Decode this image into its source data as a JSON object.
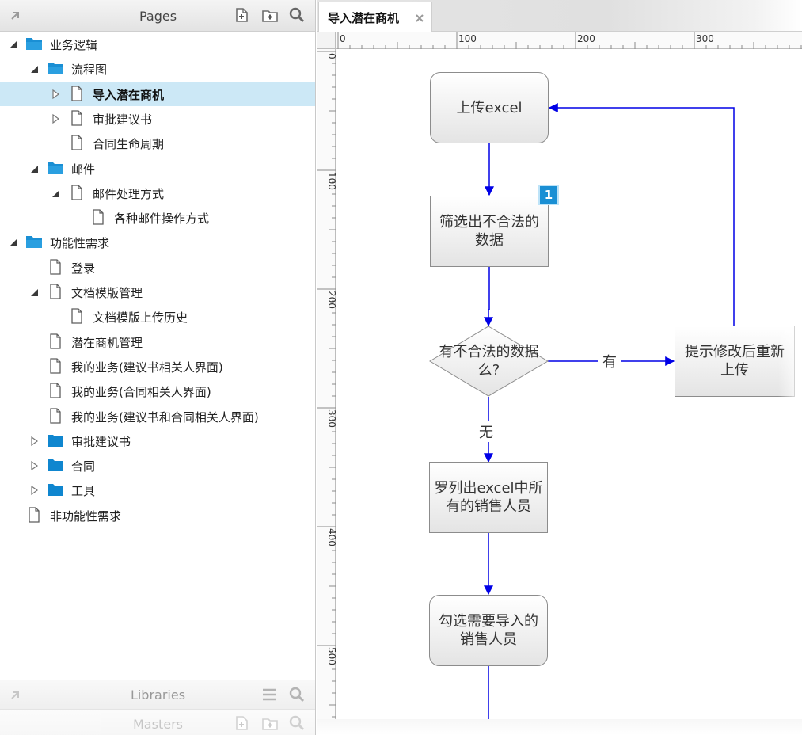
{
  "pages_panel": {
    "title": "Pages",
    "tree": [
      {
        "label": "业务逻辑",
        "icon": "folder-open-icon",
        "level": 0,
        "toggle": "expanded"
      },
      {
        "label": "流程图",
        "icon": "folder-open-icon",
        "level": 1,
        "toggle": "expanded"
      },
      {
        "label": "导入潜在商机",
        "icon": "page-icon",
        "level": 2,
        "toggle": "collapsed",
        "selected": true
      },
      {
        "label": "审批建议书",
        "icon": "page-icon",
        "level": 2,
        "toggle": "collapsed"
      },
      {
        "label": "合同生命周期",
        "icon": "page-icon",
        "level": 2,
        "toggle": "none"
      },
      {
        "label": "邮件",
        "icon": "folder-open-icon",
        "level": 1,
        "toggle": "expanded"
      },
      {
        "label": "邮件处理方式",
        "icon": "page-icon",
        "level": 2,
        "toggle": "expanded"
      },
      {
        "label": "各种邮件操作方式",
        "icon": "page-icon",
        "level": 3,
        "toggle": "none"
      },
      {
        "label": "功能性需求",
        "icon": "folder-open-icon",
        "level": 0,
        "toggle": "expanded"
      },
      {
        "label": "登录",
        "icon": "page-icon",
        "level": 1,
        "toggle": "none"
      },
      {
        "label": "文档模版管理",
        "icon": "page-icon",
        "level": 1,
        "toggle": "expanded"
      },
      {
        "label": "文档模版上传历史",
        "icon": "page-icon",
        "level": 2,
        "toggle": "none"
      },
      {
        "label": "潜在商机管理",
        "icon": "page-icon",
        "level": 1,
        "toggle": "none"
      },
      {
        "label": "我的业务(建议书相关人界面)",
        "icon": "page-icon",
        "level": 1,
        "toggle": "none"
      },
      {
        "label": "我的业务(合同相关人界面)",
        "icon": "page-icon",
        "level": 1,
        "toggle": "none"
      },
      {
        "label": "我的业务(建议书和合同相关人界面)",
        "icon": "page-icon",
        "level": 1,
        "toggle": "none"
      },
      {
        "label": "审批建议书",
        "icon": "folder-closed-icon",
        "level": 1,
        "toggle": "collapsed"
      },
      {
        "label": "合同",
        "icon": "folder-closed-icon",
        "level": 1,
        "toggle": "collapsed"
      },
      {
        "label": "工具",
        "icon": "folder-closed-icon",
        "level": 1,
        "toggle": "collapsed"
      },
      {
        "label": "非功能性需求",
        "icon": "page-icon",
        "level": 0,
        "toggle": "none"
      }
    ]
  },
  "libraries_panel": {
    "title": "Libraries"
  },
  "masters_panel": {
    "title": "Masters"
  },
  "editor": {
    "active_tab": "导入潜在商机",
    "ruler_h_labels": [
      "0",
      "100",
      "200",
      "300"
    ],
    "ruler_v_labels": [
      "0",
      "100",
      "200",
      "300",
      "400",
      "500"
    ]
  },
  "flowchart": {
    "upload": "上传excel",
    "filter": "筛选出不合法的数据",
    "decision": "有不合法的数据么?",
    "reupload": "提示修改后重新上传",
    "list_sales": "罗列出excel中所有的销售人员",
    "select_sales": "勾选需要导入的销售人员",
    "label_yes": "有",
    "label_no": "无",
    "badge": "1"
  },
  "colors": {
    "connector": "#0000e6",
    "selection": "#cce8f6",
    "folder": "#1a8fd4",
    "badge": "#1a8fd4"
  }
}
